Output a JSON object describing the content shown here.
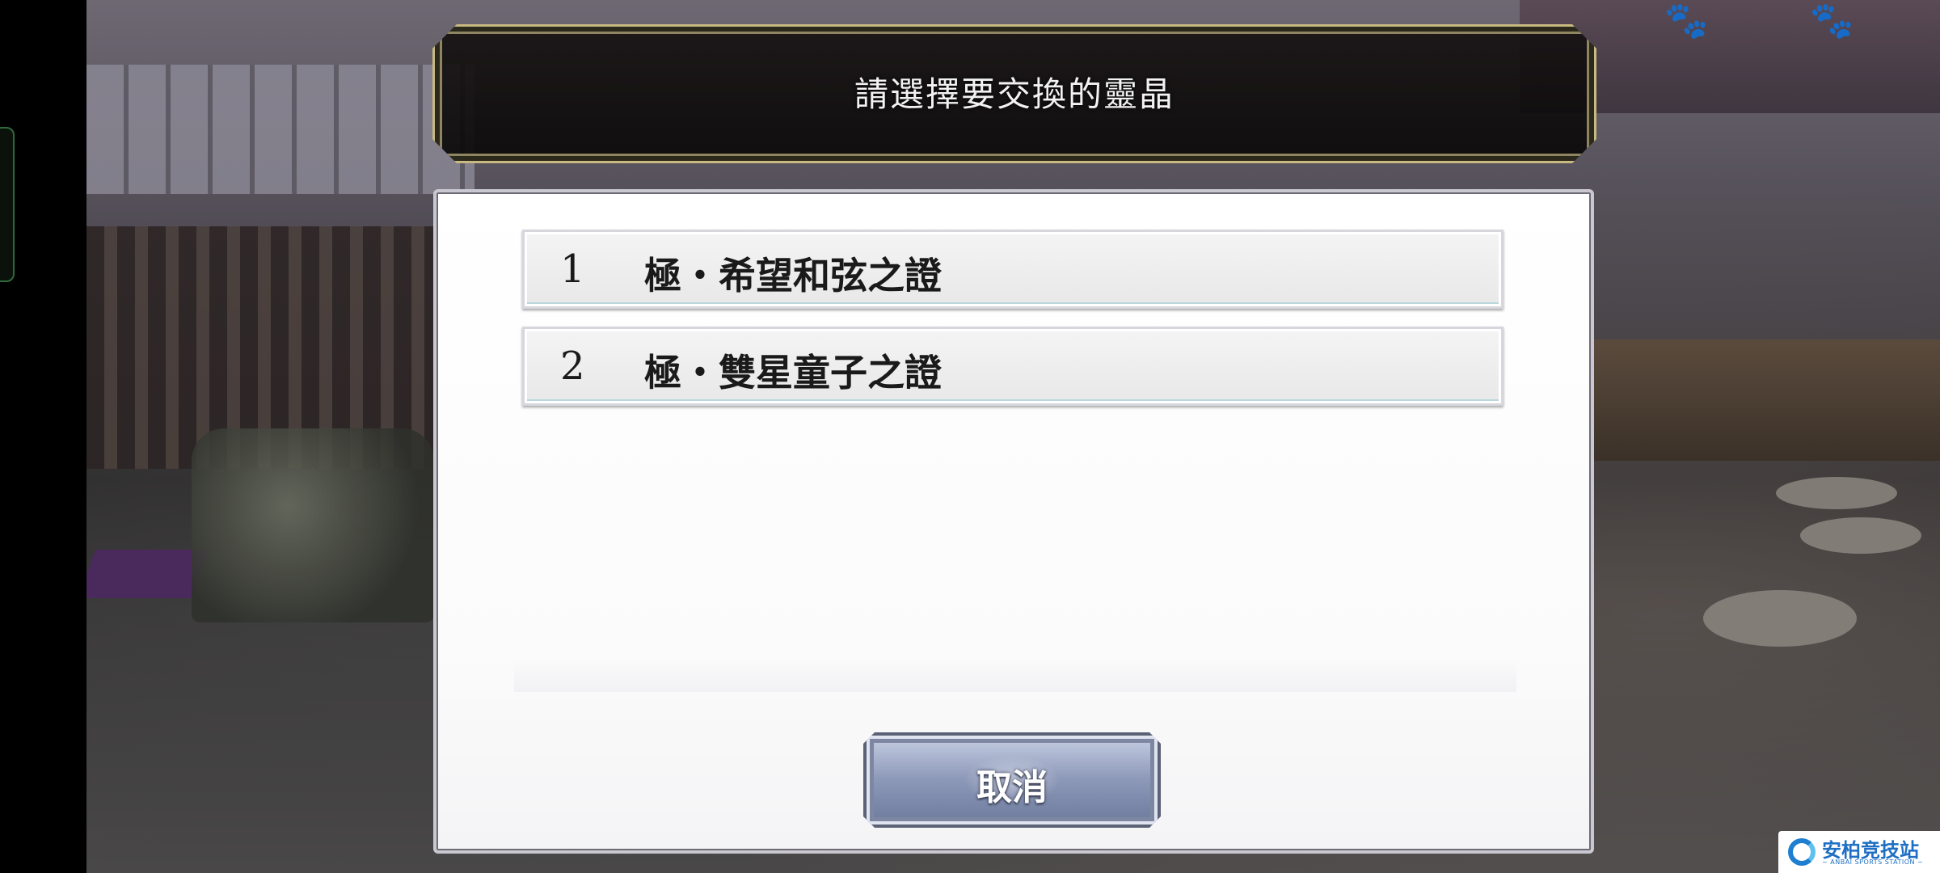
{
  "dialog": {
    "title": "請選擇要交換的靈晶",
    "items": [
      {
        "number": "1",
        "label": "極・希望和弦之證"
      },
      {
        "number": "2",
        "label": "極・雙星童子之證"
      }
    ],
    "cancel_label": "取消"
  },
  "watermark": {
    "name": "安柏竞技站",
    "subtitle": "~ ANBAI SPORTS STATION ~"
  },
  "colors": {
    "banner_border": "#c8b981",
    "panel_bg": "#ffffff",
    "cancel_button": "#8c98b8",
    "watermark_blue": "#1e6fc3"
  },
  "icons": [
    "paw-icon",
    "paw-icon",
    "anbai-logo-icon"
  ]
}
